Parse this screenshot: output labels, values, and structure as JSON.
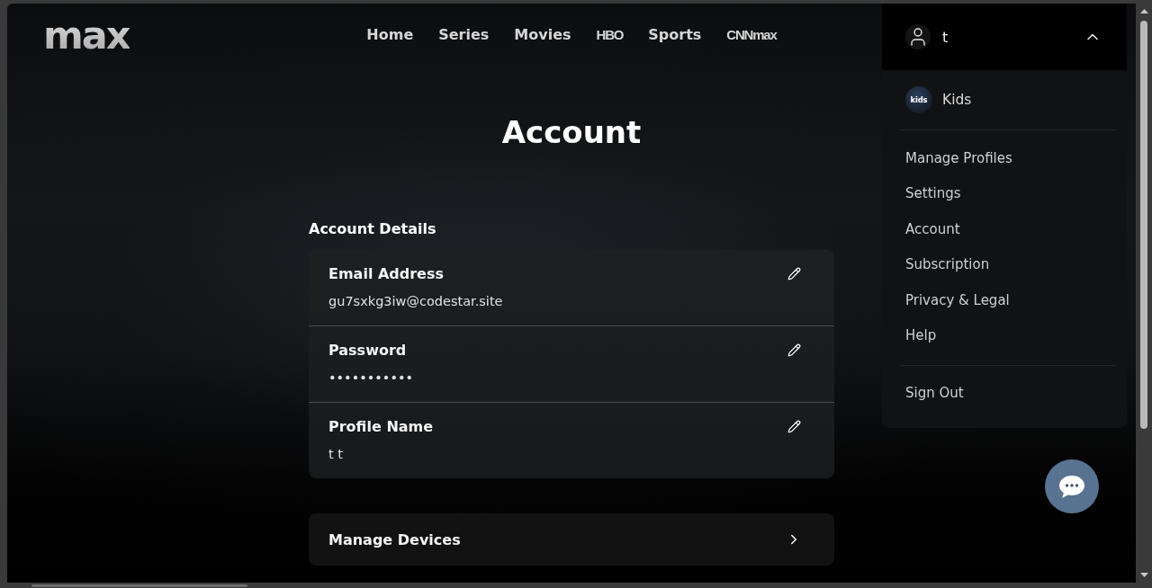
{
  "logo": {
    "text": "max"
  },
  "nav": [
    {
      "label": "Home",
      "kind": "text"
    },
    {
      "label": "Series",
      "kind": "text"
    },
    {
      "label": "Movies",
      "kind": "text"
    },
    {
      "label": "HBO",
      "kind": "logo"
    },
    {
      "label": "Sports",
      "kind": "text"
    },
    {
      "label": "CNNmax",
      "kind": "logo"
    }
  ],
  "profile_menu": {
    "name": "t",
    "expanded": true,
    "profiles": [
      {
        "name": "Kids",
        "avatar_label": "kids"
      }
    ],
    "items": [
      "Manage Profiles",
      "Settings",
      "Account",
      "Subscription",
      "Privacy & Legal",
      "Help"
    ],
    "sign_out": "Sign Out"
  },
  "page": {
    "title": "Account",
    "section_title": "Account Details",
    "details": [
      {
        "label": "Email Address",
        "value": "gu7sxkg3iw@codestar.site"
      },
      {
        "label": "Password",
        "value": "•••••••••••"
      },
      {
        "label": "Profile Name",
        "value": "t t"
      }
    ],
    "links": [
      {
        "label": "Manage Devices"
      }
    ]
  }
}
